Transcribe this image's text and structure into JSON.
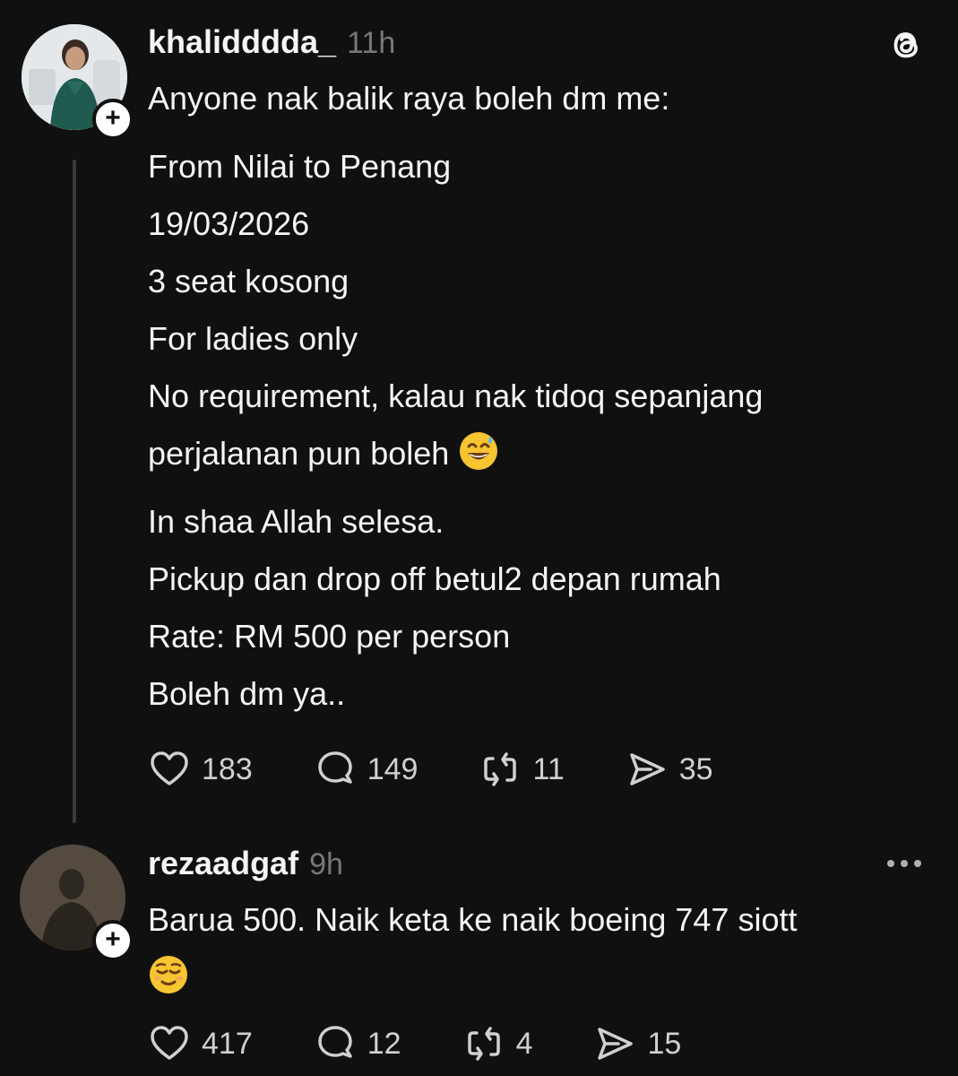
{
  "posts": [
    {
      "username": "khalidddda_",
      "time": "11h",
      "lines": [
        "Anyone nak balik raya boleh dm me:",
        "From Nilai to Penang",
        "19/03/2026",
        "3 seat kosong",
        "For ladies only",
        "No requirement, kalau nak tidoq sepanjang",
        "perjalanan pun boleh",
        "In shaa Allah selesa.",
        "Pickup dan drop off betul2 depan rumah",
        "Rate: RM 500 per person",
        "Boleh dm ya.."
      ],
      "emoji": "grinning-sweat-emoji",
      "stats": {
        "likes": "183",
        "replies": "149",
        "reposts": "11",
        "shares": "35"
      }
    },
    {
      "username": "rezaadgaf",
      "time": "9h",
      "lines": [
        "Barua 500.  Naik keta ke naik boeing 747 siott"
      ],
      "emoji": "relieved-emoji",
      "stats": {
        "likes": "417",
        "replies": "12",
        "reposts": "4",
        "shares": "15"
      }
    }
  ],
  "icons": {
    "app_logo": "threads-logo-icon",
    "more": "more-options-icon",
    "like": "heart-icon",
    "reply": "comment-icon",
    "repost": "repost-icon",
    "share": "share-icon",
    "follow": "plus-icon"
  },
  "colors": {
    "background": "#101010",
    "text": "#f3f5f7",
    "muted": "#777777",
    "thread_line": "#3a3a3a"
  }
}
